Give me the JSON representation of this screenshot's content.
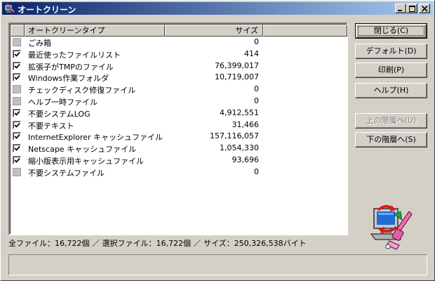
{
  "window": {
    "title": "オートクリーン"
  },
  "list": {
    "columns": [
      "オートクリーンタイプ",
      "サイズ"
    ],
    "rows": [
      {
        "checked": false,
        "name": "ごみ箱",
        "size": "0"
      },
      {
        "checked": true,
        "name": "最近使ったファイルリスト",
        "size": "414"
      },
      {
        "checked": true,
        "name": "拡張子がTMPのファイル",
        "size": "76,399,017"
      },
      {
        "checked": true,
        "name": "Windows作業フォルダ",
        "size": "10,719,007"
      },
      {
        "checked": false,
        "name": "チェックディスク修復ファイル",
        "size": "0"
      },
      {
        "checked": false,
        "name": "ヘルプ一時ファイル",
        "size": "0"
      },
      {
        "checked": true,
        "name": "不要システムLOG",
        "size": "4,912,551"
      },
      {
        "checked": true,
        "name": "不要テキスト",
        "size": "31,466"
      },
      {
        "checked": true,
        "name": "InternetExplorer キャッシュファイル",
        "size": "157,116,057"
      },
      {
        "checked": true,
        "name": "Netscape キャッシュファイル",
        "size": "1,054,330"
      },
      {
        "checked": true,
        "name": "縮小版表示用キャッシュファイル",
        "size": "93,696"
      },
      {
        "checked": false,
        "name": "不要システムファイル",
        "size": "0"
      }
    ]
  },
  "status": {
    "text": "全ファイル：16,722個 ／ 選択ファイル：16,722個 ／ サイズ：250,326,538バイト"
  },
  "buttons": {
    "close": "閉じる(C)",
    "default": "デフォルト(D)",
    "print": "印刷(P)",
    "help": "ヘルプ(H)",
    "up": "上の階層へ(U)",
    "down": "下の階層へ(S)"
  },
  "colors": {
    "face": "#d4d0c8",
    "title_start": "#0a246a",
    "title_end": "#a6caf0"
  },
  "icons": {
    "title": "cleaner-app-icon",
    "art": "computer-recycle-cleaner-icon"
  }
}
